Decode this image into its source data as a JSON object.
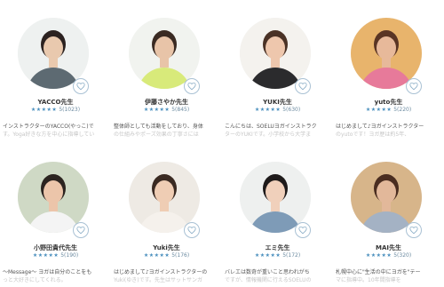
{
  "instructors": [
    {
      "name": "YACCO先生",
      "stars": "★★★★★",
      "score": "5(1023)",
      "bio_line1": "インストラクターのYACCO(やっこ)で",
      "bio_line2": "す。Yoga好きな方を中心に指導してい",
      "colors": {
        "bg": "#eef1f0",
        "skin": "#e9c9ae",
        "hair": "#2b2220",
        "top": "#5d6a72"
      }
    },
    {
      "name": "伊藤さやか先生",
      "stars": "★★★★★",
      "score": "5(845)",
      "bio_line1": "整体師としても活動をしており、身体",
      "bio_line2": "の仕組みやポーズ効果の丁寧さには",
      "colors": {
        "bg": "#f1f3ef",
        "skin": "#e8c4a8",
        "hair": "#3a2a22",
        "top": "#d8ea7a"
      }
    },
    {
      "name": "YUKI先生",
      "stars": "★★★★★",
      "score": "5(630)",
      "bio_line1": "こんにちは、SOELUヨガインストラク",
      "bio_line2": "ターのYUKIです。小学校から大学ま",
      "colors": {
        "bg": "#f4f2ee",
        "skin": "#eec7ad",
        "hair": "#4a3226",
        "top": "#2b2b2d"
      }
    },
    {
      "name": "yuto先生",
      "stars": "★★★★★",
      "score": "5(220)",
      "bio_line1": "はじめまして♪ヨガインストラクター",
      "bio_line2": "のyutoです！ヨガ歴は約5年、",
      "colors": {
        "bg": "#e8b46c",
        "skin": "#e7b99a",
        "hair": "#5a3524",
        "top": "#e77a9a"
      }
    },
    {
      "name": "小野田貴代先生",
      "stars": "★★★★★",
      "score": "5(190)",
      "bio_line1": "～Message～ ヨガは自分のことをも",
      "bio_line2": "っと大好きにしてくれる。",
      "colors": {
        "bg": "#cfd9c5",
        "skin": "#ecc5aa",
        "hair": "#2c2420",
        "top": "#f4f4f4"
      }
    },
    {
      "name": "Yuki先生",
      "stars": "★★★★★",
      "score": "5(176)",
      "bio_line1": "はじめまして♪ヨガインストラクターの",
      "bio_line2": "Yuki(ゆき)です。先生はサットサンガ",
      "colors": {
        "bg": "#eeeae4",
        "skin": "#efcdb4",
        "hair": "#3a2a22",
        "top": "#f5f1ec"
      }
    },
    {
      "name": "エミ先生",
      "stars": "★★★★★",
      "score": "5(172)",
      "bio_line1": "バレエは数奇が重いこと思われがち",
      "bio_line2": "ですが、情報機関に行えるSOELUの",
      "colors": {
        "bg": "#eef0ef",
        "skin": "#f0d0bb",
        "hair": "#1e1a1a",
        "top": "#7e9bb7"
      }
    },
    {
      "name": "MAI先生",
      "stars": "★★★★★",
      "score": "5(320)",
      "bio_line1": "札幌中心に\"生活の中にヨガを\"テー",
      "bio_line2": "マに指導中。10年間指導を",
      "colors": {
        "bg": "#d7b58a",
        "skin": "#e2b89a",
        "hair": "#4a2d20",
        "top": "#a4b2c4"
      }
    }
  ]
}
